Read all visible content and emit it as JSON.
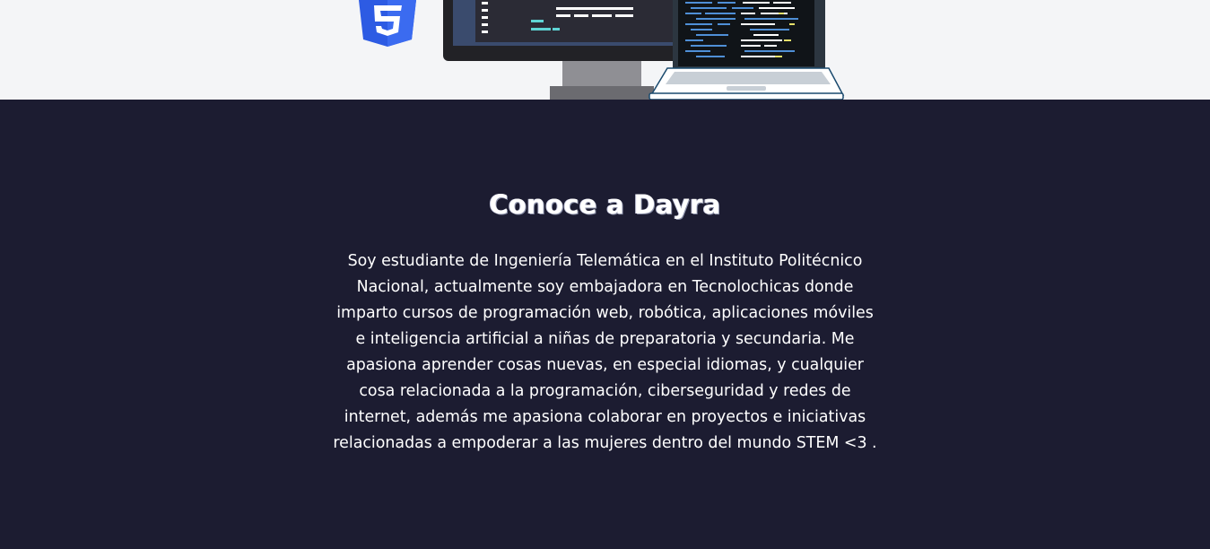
{
  "about": {
    "title": "Conoce a Dayra",
    "description": "Soy estudiante de Ingeniería Telemática en el Instituto Politécnico Nacional, actualmente soy embajadora en Tecnolochicas donde imparto cursos de programación web, robótica, aplicaciones móviles e inteligencia artificial a niñas de preparatoria y secundaria. Me apasiona aprender cosas nuevas, en especial idiomas, y cualquier cosa relacionada a la programación, ciberseguridad y redes de internet, además me apasiona colaborar en proyectos e iniciativas relacionadas a empoderar a las mujeres dentro del mundo STEM <3 ."
  },
  "colors": {
    "hero_background": "#f4f5f7",
    "about_background": "#1c1c31",
    "css3_badge": "#2d5be3",
    "text": "#ffffff"
  },
  "icons": [
    "css3-icon",
    "desktop-monitor-illustration",
    "laptop-illustration"
  ]
}
